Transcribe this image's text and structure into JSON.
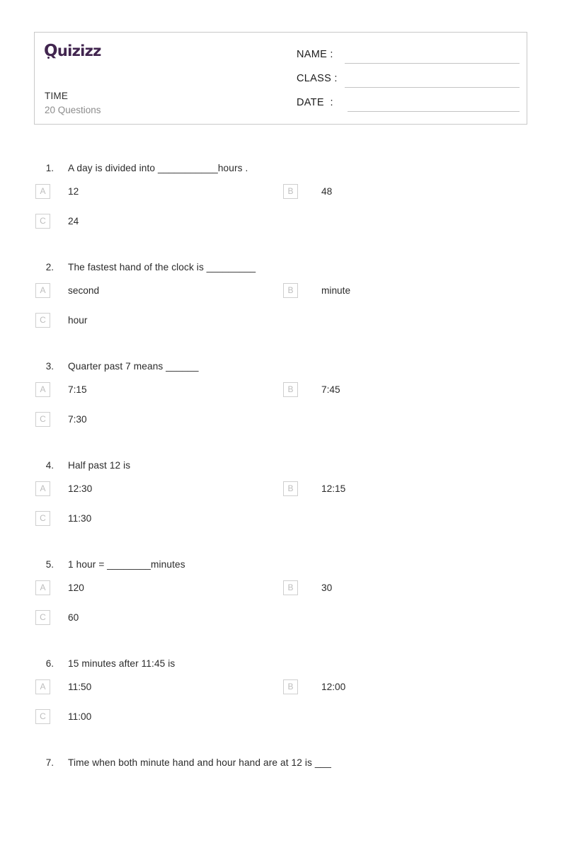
{
  "brand": {
    "logo_text": "Quizizz",
    "logo_q": "Q",
    "logo_rest": "uizizz",
    "logo_color": "#41254f"
  },
  "header": {
    "quiz_title": "TIME",
    "quiz_subtitle": "20 Questions",
    "fields": [
      {
        "label": "NAME :",
        "value": ""
      },
      {
        "label": "CLASS :",
        "value": ""
      },
      {
        "label": "DATE  :",
        "value": ""
      }
    ]
  },
  "questions": [
    {
      "number": "1.",
      "text": "A day is divided into ___________hours .",
      "options": [
        {
          "letter": "A",
          "text": "12"
        },
        {
          "letter": "B",
          "text": "48"
        },
        {
          "letter": "C",
          "text": "24"
        }
      ]
    },
    {
      "number": "2.",
      "text": "The fastest hand of the clock is _________",
      "options": [
        {
          "letter": "A",
          "text": "second"
        },
        {
          "letter": "B",
          "text": "minute"
        },
        {
          "letter": "C",
          "text": "hour"
        }
      ]
    },
    {
      "number": "3.",
      "text": "Quarter past 7 means ______",
      "options": [
        {
          "letter": "A",
          "text": "7:15"
        },
        {
          "letter": "B",
          "text": "7:45"
        },
        {
          "letter": "C",
          "text": "7:30"
        }
      ]
    },
    {
      "number": "4.",
      "text": "Half past 12 is",
      "options": [
        {
          "letter": "A",
          "text": "12:30"
        },
        {
          "letter": "B",
          "text": "12:15"
        },
        {
          "letter": "C",
          "text": "11:30"
        }
      ]
    },
    {
      "number": "5.",
      "text": "1 hour = ________minutes",
      "options": [
        {
          "letter": "A",
          "text": "120"
        },
        {
          "letter": "B",
          "text": "30"
        },
        {
          "letter": "C",
          "text": "60"
        }
      ]
    },
    {
      "number": "6.",
      "text": "15 minutes after 11:45 is",
      "options": [
        {
          "letter": "A",
          "text": "11:50"
        },
        {
          "letter": "B",
          "text": "12:00"
        },
        {
          "letter": "C",
          "text": "11:00"
        }
      ]
    },
    {
      "number": "7.",
      "text": "Time when both minute hand and hour hand are at 12 is ___",
      "options": []
    }
  ]
}
